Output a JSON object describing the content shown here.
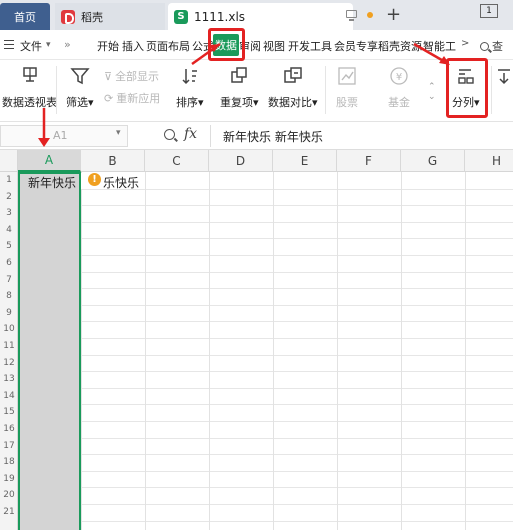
{
  "tabs": {
    "home": "首页",
    "docer": "稻壳",
    "file": "1111.xls",
    "file_icon": "S",
    "new_tab": "+",
    "page_indicator": "1"
  },
  "menu": {
    "file": "文件",
    "items": [
      "开始",
      "插入",
      "页面布局",
      "公式",
      "审阅",
      "视图",
      "开发工具",
      "会员专享",
      "稻壳资源",
      "智能工"
    ],
    "active": "数据",
    "more": ">",
    "search": "查"
  },
  "ribbon": {
    "pivot": "数据透视表",
    "filter": "筛选",
    "show_all": "全部显示",
    "reapply": "重新应用",
    "sort": "排序",
    "duplicates": "重复项",
    "compare": "数据对比",
    "stocks": "股票",
    "fund": "基金",
    "split": "分列"
  },
  "formula_bar": {
    "name_box": "A1",
    "fx": "fx",
    "content": "新年快乐  新年快乐"
  },
  "grid": {
    "columns": [
      "A",
      "B",
      "C",
      "D",
      "E",
      "F",
      "G",
      "H"
    ],
    "rows": [
      "1",
      "2",
      "3",
      "4",
      "5",
      "6",
      "7",
      "8",
      "9",
      "10",
      "11",
      "12",
      "13",
      "14",
      "15",
      "16",
      "17",
      "18",
      "19",
      "20",
      "21"
    ],
    "cell_a1": "新年快乐",
    "cell_b1_visible": "乐快乐",
    "warning_icon": "!"
  },
  "colors": {
    "accent": "#1a9a5b",
    "annotation": "#e32222",
    "home_tab": "#3f5f8f"
  }
}
